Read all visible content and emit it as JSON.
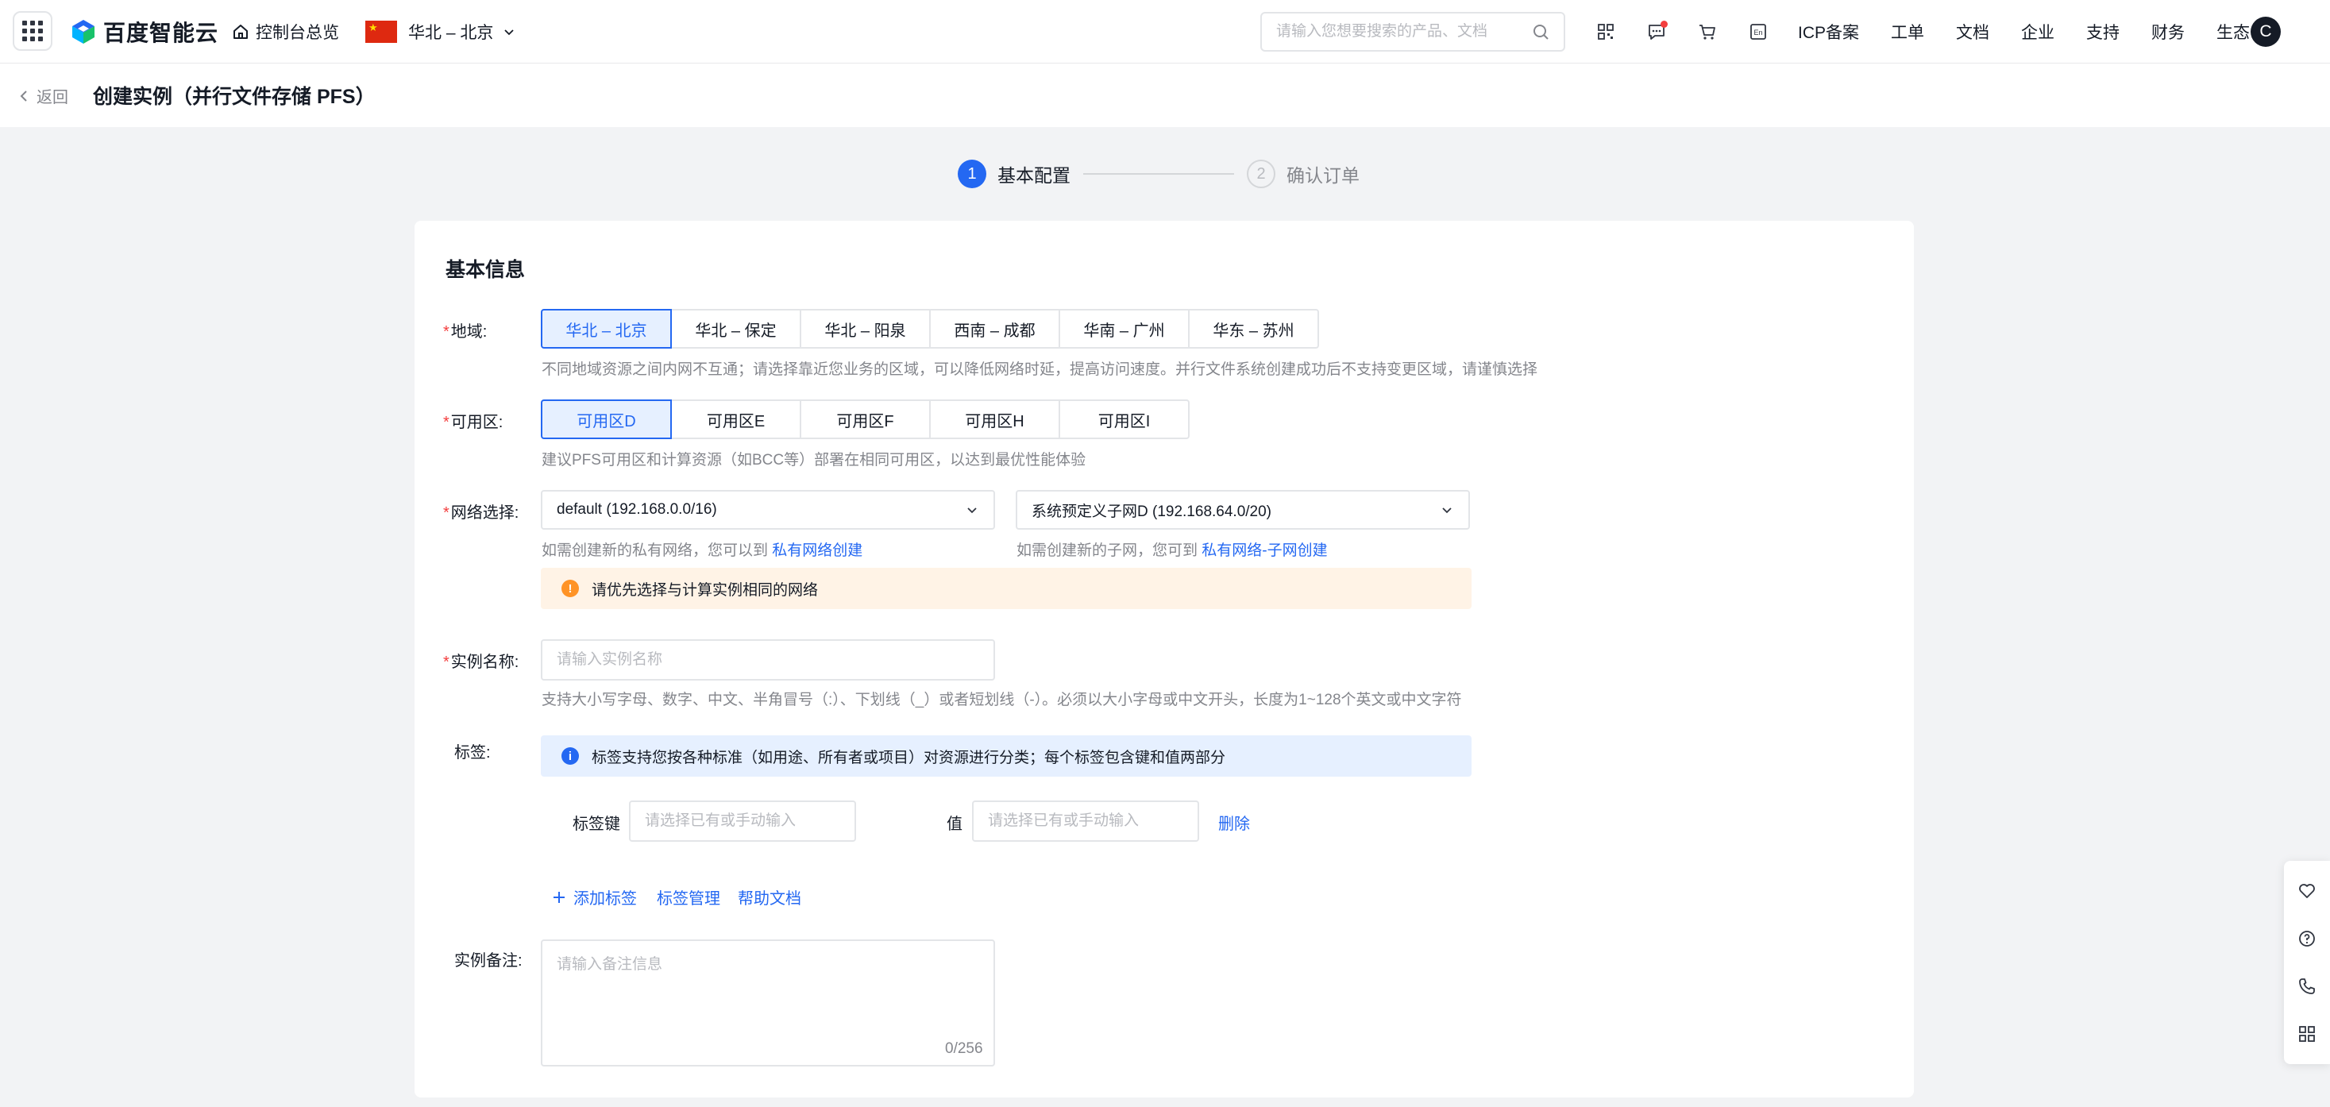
{
  "topnav": {
    "logo_text": "百度智能云",
    "home_label": "控制台总览",
    "region_label": "华北 – 北京",
    "search_placeholder": "请输入您想要搜索的产品、文档",
    "links": [
      "ICP备案",
      "工单",
      "文档",
      "企业",
      "支持",
      "财务",
      "生态"
    ],
    "avatar_letter": "C",
    "icons": [
      "qrcode-icon",
      "message-icon",
      "cart-icon",
      "en-language-icon"
    ]
  },
  "header": {
    "back_label": "返回",
    "title": "创建实例（并行文件存储 PFS）"
  },
  "steps": [
    {
      "num": "1",
      "label": "基本配置",
      "active": true
    },
    {
      "num": "2",
      "label": "确认订单",
      "active": false
    }
  ],
  "form": {
    "section_title": "基本信息",
    "region": {
      "label": "地域:",
      "options": [
        "华北 – 北京",
        "华北 – 保定",
        "华北 – 阳泉",
        "西南 – 成都",
        "华南 – 广州",
        "华东 – 苏州"
      ],
      "selected": "华北 – 北京",
      "hint": "不同地域资源之间内网不互通；请选择靠近您业务的区域，可以降低网络时延，提高访问速度。并行文件系统创建成功后不支持变更区域，请谨慎选择"
    },
    "zone": {
      "label": "可用区:",
      "options": [
        "可用区D",
        "可用区E",
        "可用区F",
        "可用区H",
        "可用区I"
      ],
      "selected": "可用区D",
      "hint": "建议PFS可用区和计算资源（如BCC等）部署在相同可用区，以达到最优性能体验"
    },
    "network": {
      "label": "网络选择:",
      "vpc_value": "default (192.168.0.0/16)",
      "subnet_value": "系统预定义子网D (192.168.64.0/20)",
      "vpc_hint": "如需创建新的私有网络，您可以到",
      "vpc_link": "私有网络创建",
      "subnet_hint": "如需创建新的子网，您可到",
      "subnet_link": "私有网络-子网创建",
      "warning": "请优先选择与计算实例相同的网络"
    },
    "instance_name": {
      "label": "实例名称:",
      "placeholder": "请输入实例名称",
      "hint": "支持大小写字母、数字、中文、半角冒号（:）、下划线（_）或者短划线（-）。必须以大小字母或中文开头，长度为1~128个英文或中文字符"
    },
    "tags": {
      "label": "标签:",
      "info": "标签支持您按各种标准（如用途、所有者或项目）对资源进行分类；每个标签包含键和值两部分",
      "key_label": "标签键",
      "key_placeholder": "请选择已有或手动输入",
      "value_label": "值",
      "value_placeholder": "请选择已有或手动输入",
      "delete_label": "删除",
      "add_label": "添加标签",
      "manage_label": "标签管理",
      "help_label": "帮助文档"
    },
    "remark": {
      "label": "实例备注:",
      "placeholder": "请输入备注信息",
      "counter": "0/256"
    }
  },
  "floatbar": [
    "favorite-icon",
    "help-icon",
    "phone-icon",
    "apps-icon"
  ],
  "colors": {
    "primary": "#2468f2",
    "warning": "#ff9326",
    "danger": "#f33e3e",
    "text": "#151b26",
    "muted": "#84868c"
  }
}
